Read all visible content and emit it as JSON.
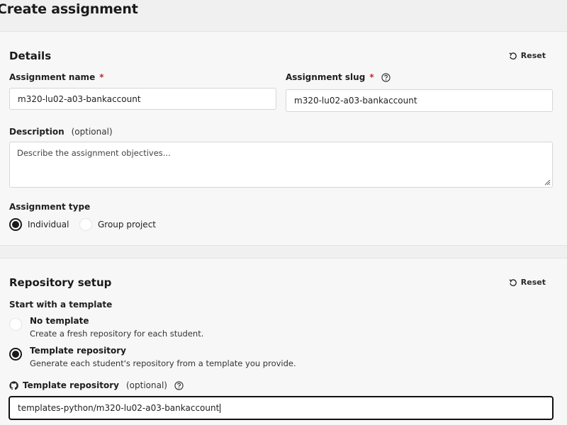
{
  "page": {
    "title": "Create assignment"
  },
  "details": {
    "title": "Details",
    "reset_label": "Reset",
    "name_label": "Assignment name",
    "name_required": "*",
    "name_value": "m320-lu02-a03-bankaccount",
    "slug_label": "Assignment slug",
    "slug_required": "*",
    "slug_value": "m320-lu02-a03-bankaccount",
    "description_label": "Description",
    "description_optional": "(optional)",
    "description_placeholder": "Describe the assignment objectives...",
    "type_label": "Assignment type",
    "type_options": [
      {
        "label": "Individual",
        "checked": true
      },
      {
        "label": "Group project",
        "checked": false
      }
    ]
  },
  "repo": {
    "title": "Repository setup",
    "reset_label": "Reset",
    "start_label": "Start with a template",
    "options": [
      {
        "title": "No template",
        "desc": "Create a fresh repository for each student.",
        "checked": false
      },
      {
        "title": "Template repository",
        "desc": "Generate each student's repository from a template you provide.",
        "checked": true
      }
    ],
    "template_label": "Template repository",
    "template_optional": "(optional)",
    "template_value": "templates-python/m320-lu02-a03-bankaccount"
  }
}
